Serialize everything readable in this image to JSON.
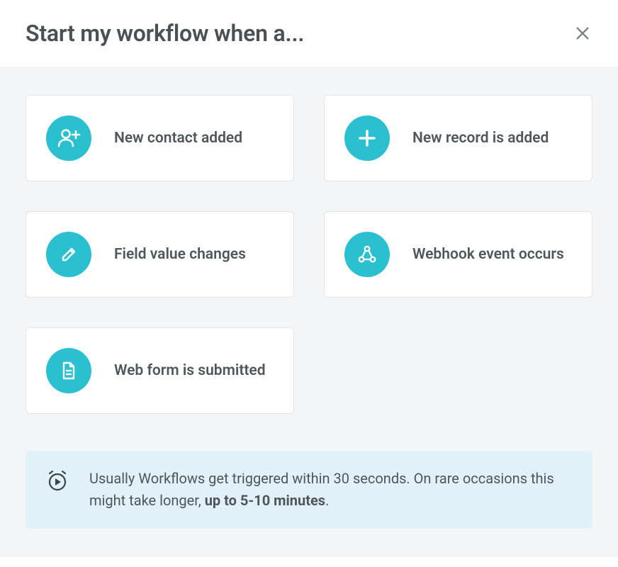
{
  "header": {
    "title": "Start my workflow when a..."
  },
  "triggers": [
    {
      "icon": "person-plus-icon",
      "label": "New contact added"
    },
    {
      "icon": "plus-icon",
      "label": "New record is added"
    },
    {
      "icon": "pencil-icon",
      "label": "Field value changes"
    },
    {
      "icon": "webhook-icon",
      "label": "Webhook event occurs"
    },
    {
      "icon": "form-icon",
      "label": "Web form is submitted"
    }
  ],
  "notice": {
    "prefix": "Usually Workflows get triggered within 30 seconds. On rare occasions this might take longer, ",
    "bold": "up to 5-10 minutes",
    "suffix": "."
  }
}
